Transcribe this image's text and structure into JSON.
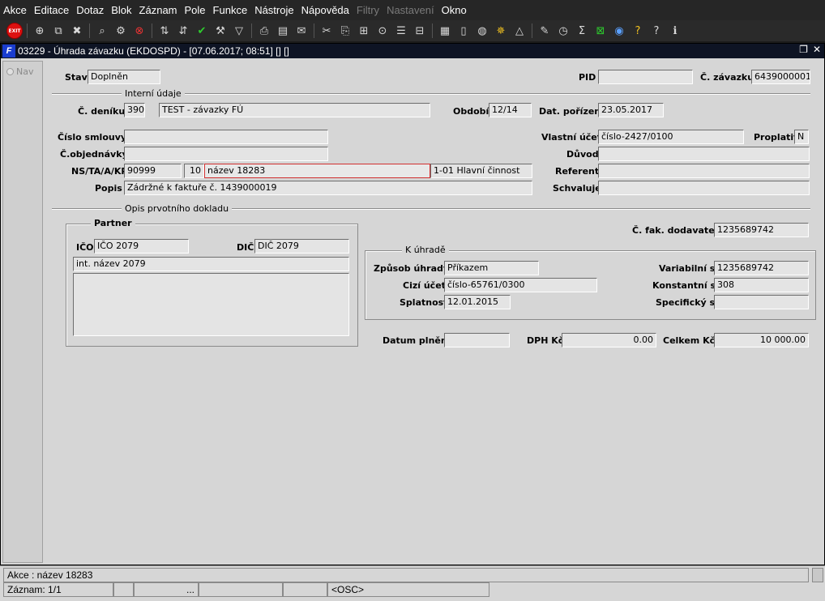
{
  "menubar": {
    "items": [
      "Akce",
      "Editace",
      "Dotaz",
      "Blok",
      "Záznam",
      "Pole",
      "Funkce",
      "Nástroje",
      "Nápověda",
      "Filtry",
      "Nastavení",
      "Okno"
    ]
  },
  "toolbar": {
    "exit_label": "EXIT"
  },
  "window": {
    "title": "03229 - Úhrada závazku (EKDOSPD) - [07.06.2017; 08:51] [] []",
    "logo": "F"
  },
  "nav": {
    "label": "Nav"
  },
  "form": {
    "stav_label": "Stav",
    "stav_value": "Doplněn",
    "pid_label": "PID",
    "pid_value": "",
    "zavazku_label": "Č. závazku",
    "zavazku_value": "6439000001",
    "interni_head": "Interní údaje",
    "denik_label": "Č. deníku",
    "denik_value": "390",
    "denik_name": "TEST - závazky FÚ",
    "obdobi_label": "Období",
    "obdobi_value": "12/14",
    "datporiz_label": "Dat. pořízení",
    "datporiz_value": "23.05.2017",
    "smlouvy_label": "Číslo smlouvy",
    "smlouvy_value": "",
    "vlucet_label": "Vlastní účet",
    "vlucet_value": "číslo-2427/0100",
    "proplatit_label": "Proplatit",
    "proplatit_value": "N",
    "objednavky_label": "Č.objednávky",
    "objednavky_value": "",
    "duvod_label": "Důvod",
    "duvod_value": "",
    "nstaakp_label": "NS/TA/A/KP",
    "ns_value": "90999",
    "ta_value": "10",
    "a_value": "název 18283",
    "kp_value": "1-01 Hlavní činnost",
    "referent_label": "Referent",
    "referent_value": "",
    "popis_label": "Popis",
    "popis_value": "Zádržné k faktuře č. 1439000019",
    "schvaluje_label": "Schvaluje",
    "schvaluje_value": "",
    "opis_head": "Opis prvotního dokladu",
    "partner_head": "Partner",
    "ico_label": "IČO",
    "ico_value": "IČO 2079",
    "dic_label": "DIČ",
    "dic_value": "DIČ 2079",
    "partner_name": "int. název 2079",
    "partner_address": "",
    "fakdod_label": "Č. fak. dodavatele",
    "fakdod_value": "1235689742",
    "kuhrade_head": "K úhradě",
    "zpusob_label": "Způsob úhrady",
    "zpusob_value": "Příkazem",
    "varsym_label": "Variabilní s.",
    "varsym_value": "1235689742",
    "cizi_label": "Cizí účet",
    "cizi_value": "číslo-65761/0300",
    "konst_label": "Konstantní s.",
    "konst_value": "308",
    "splat_label": "Splatnost",
    "splat_value": "12.01.2015",
    "spec_label": "Specifický s.",
    "spec_value": "",
    "datplneni_label": "Datum plnění",
    "datplneni_value": "",
    "dph_label": "DPH Kč",
    "dph_value": "0.00",
    "celkem_label": "Celkem Kč",
    "celkem_value": "10 000.00"
  },
  "status": {
    "line1": "Akce : název 18283",
    "record": "Záznam: 1/1",
    "ellipsis": "...",
    "osc": "<OSC>"
  }
}
